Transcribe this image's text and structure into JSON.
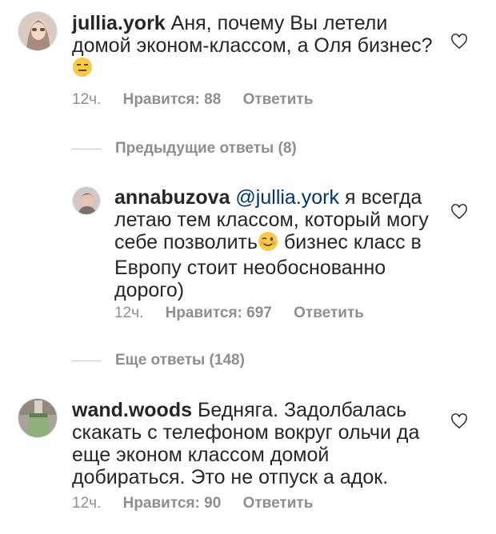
{
  "comments": [
    {
      "username": "jullia.york",
      "text": " Аня, почему Вы летели домой эконом-классом, а Оля бизнес?",
      "emoji": "expressionless-face-emoji",
      "time": "12ч.",
      "likes": "Нравится: 88",
      "reply": "Ответить"
    },
    {
      "username": "annabuzova",
      "mention": " @jullia.york",
      "text_before_emoji": " я всегда летаю тем классом, который могу себе позволить",
      "emoji": "winking-face-emoji",
      "text_after_emoji": " бизнес класс в Европу стоит необоснованно дорого)",
      "time": "12ч.",
      "likes": "Нравится: 697",
      "reply": "Ответить"
    },
    {
      "username": "wand.woods",
      "text": " Бедняга. Задолбалась скакать с телефоном вокруг ольчи да еще эконом классом домой добираться. Это не отпуск а адок.",
      "time": "12ч.",
      "likes": "Нравится: 90",
      "reply": "Ответить"
    }
  ],
  "threads": {
    "previous_replies": "Предыдущие ответы (8)",
    "more_replies": "Еще ответы (148)"
  },
  "icons": {
    "like": "heart-outline-icon"
  },
  "colors": {
    "text": "#262626",
    "secondary": "#8e8e8e",
    "mention": "#00376b"
  }
}
